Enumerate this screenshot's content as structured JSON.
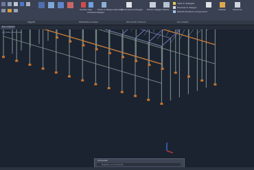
{
  "ribbon": {
    "groups": [
      "Oggetti",
      "Modellazione base",
      "Strumenti di lavoro",
      "Documenti"
    ],
    "labels": [
      "Verifica assi",
      "Cantiere Disegni",
      "Trave a disegni standard",
      "Numerazione Disegni",
      "Elenco disegni",
      "Piante",
      "Vista di dettaglio",
      "Processi di disegno",
      "Modelli struttura componenti",
      "Iniziale",
      "Gestione"
    ]
  },
  "document_tab": {
    "label": "Documento1"
  },
  "viewport": {
    "title": "[-][Vista personale]"
  },
  "command_line": {
    "label": "Comando:",
    "placeholder": "Digitare un comando"
  },
  "colors": {
    "background": "#1b2331",
    "ribbon": "#3a4152",
    "steel_columns": "#7a8c86",
    "longitudinal_beams": "#c47a35",
    "roof_trusses": "#6e5fa8",
    "ucs_z": "#3a6dd8",
    "ucs_x": "#d13a3a"
  }
}
